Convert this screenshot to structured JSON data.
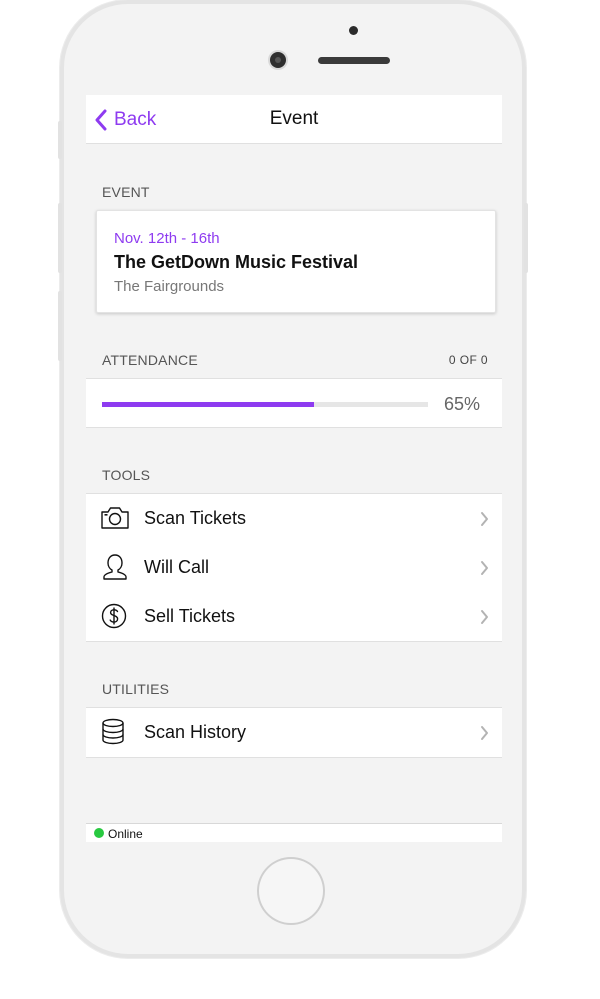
{
  "nav": {
    "back_label": "Back",
    "title": "Event"
  },
  "event_section": {
    "header": "EVENT",
    "date": "Nov. 12th - 16th",
    "name": "The GetDown Music Festival",
    "venue": "The Fairgrounds"
  },
  "attendance": {
    "header": "ATTENDANCE",
    "count": "0 OF 0",
    "progress_fraction": 0.65,
    "percent_label": "65%"
  },
  "tools": {
    "header": "TOOLS",
    "items": [
      {
        "label": "Scan Tickets",
        "icon": "camera-icon"
      },
      {
        "label": "Will Call",
        "icon": "person-icon"
      },
      {
        "label": "Sell Tickets",
        "icon": "dollar-icon"
      }
    ]
  },
  "utilities": {
    "header": "UTILITIES",
    "items": [
      {
        "label": "Scan History",
        "icon": "database-icon"
      }
    ]
  },
  "status": {
    "text": "Online",
    "color": "#28c940"
  },
  "colors": {
    "accent": "#8e3bf0"
  }
}
